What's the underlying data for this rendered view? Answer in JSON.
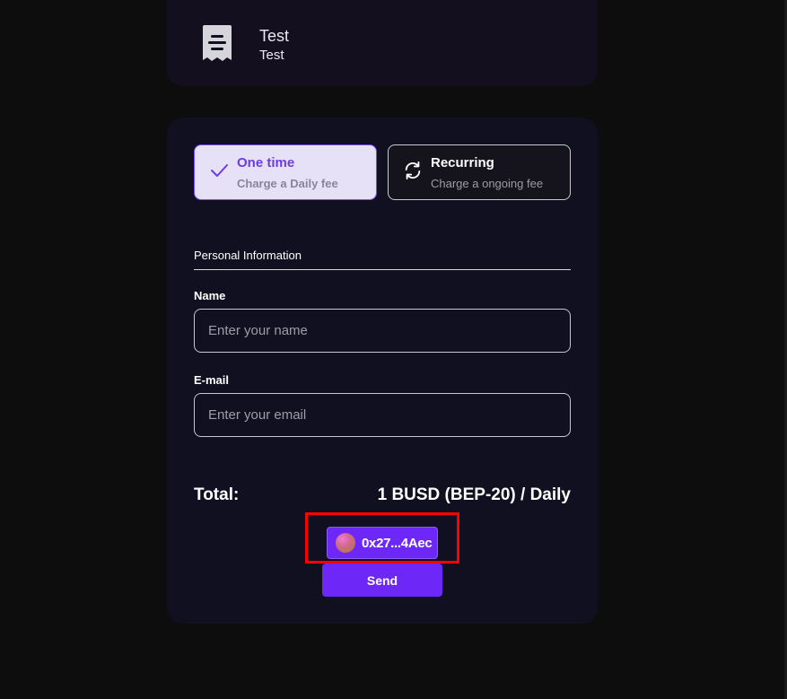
{
  "header": {
    "icon": "receipt-icon",
    "title": "Test",
    "subtitle": "Test"
  },
  "payment_options": [
    {
      "icon": "check-icon",
      "title": "One time",
      "description": "Charge a Daily fee",
      "selected": true
    },
    {
      "icon": "refresh-icon",
      "title": "Recurring",
      "description": "Charge a ongoing fee",
      "selected": false
    }
  ],
  "form": {
    "section_title": "Personal Information",
    "name_label": "Name",
    "name_placeholder": "Enter your name",
    "name_value": "",
    "email_label": "E-mail",
    "email_placeholder": "Enter your email",
    "email_value": ""
  },
  "total": {
    "label": "Total:",
    "value": "1 BUSD (BEP-20) / Daily"
  },
  "wallet": {
    "address": "0x27...4Aec",
    "avatar_icon": "wallet-avatar-icon"
  },
  "send_label": "Send",
  "colors": {
    "accent": "#6d28f7",
    "selected_bg": "#e6e1f6",
    "card_bg": "#101020",
    "page_bg": "#0d0d0e",
    "highlight": "#ff0000"
  }
}
